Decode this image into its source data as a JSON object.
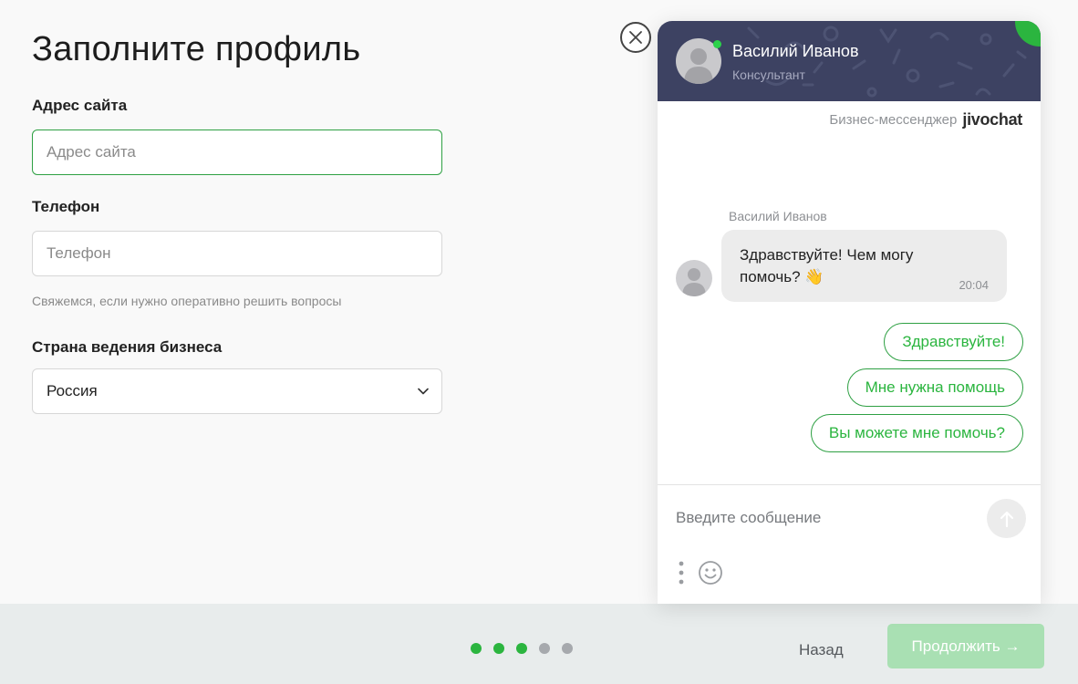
{
  "form": {
    "title": "Заполните профиль",
    "website": {
      "label": "Адрес сайта",
      "placeholder": "Адрес сайта",
      "value": ""
    },
    "phone": {
      "label": "Телефон",
      "placeholder": "Телефон",
      "value": "",
      "hint": "Свяжемся, если нужно оперативно решить вопросы"
    },
    "country": {
      "label": "Страна ведения бизнеса",
      "selected": "Россия"
    }
  },
  "footer": {
    "progress": {
      "total": 5,
      "completed": 3
    },
    "back_label": "Назад",
    "continue_label": "Продолжить →"
  },
  "chat": {
    "agent": {
      "name": "Василий Иванов",
      "role": "Консультант",
      "status": "online"
    },
    "branding": {
      "text": "Бизнес-мессенджер",
      "logo_text": "jivochat"
    },
    "message": {
      "sender": "Василий Иванов",
      "text": "Здравствуйте! Чем могу помочь? 👋",
      "time": "20:04"
    },
    "quick_replies": [
      "Здравствуйте!",
      "Мне нужна помощь",
      "Вы можете мне помочь?"
    ],
    "composer": {
      "placeholder": "Введите сообщение"
    },
    "icons": [
      "close-icon",
      "send-arrow-icon",
      "more-vertical-icon",
      "emoji-icon",
      "chevron-down-icon",
      "person-icon"
    ],
    "colors": {
      "accent": "#2bb53f",
      "header": "#3d4262",
      "continue_disabled": "#a9e0b3"
    }
  }
}
